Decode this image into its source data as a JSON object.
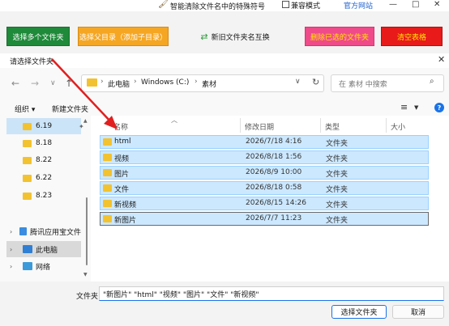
{
  "app": {
    "title": "智能清除文件名中的特殊符号",
    "compat_label": "兼容模式",
    "official_link": "官方网站",
    "toolbar": {
      "select_folders": "选择多个文件夹",
      "select_parent": "选择父目录（添加子目录）",
      "swap_names": "新旧文件夹名互换",
      "delete_selected": "删除已选的文件夹",
      "clear_table": "清空表格"
    }
  },
  "dialog": {
    "title": "请选择文件夹",
    "breadcrumb": [
      "此电脑",
      "Windows (C:)",
      "素材"
    ],
    "search_placeholder": "在 素材 中搜索",
    "organize_label": "组织 ▾",
    "new_folder_label": "新建文件夹",
    "nav_items": [
      "6.19",
      "8.18",
      "8.22",
      "6.22",
      "8.23"
    ],
    "tree": {
      "tencent": "腾讯应用宝文件",
      "thispc": "此电脑",
      "network": "网络"
    },
    "columns": {
      "name": "名称",
      "modified": "修改日期",
      "type": "类型",
      "size": "大小"
    },
    "files": [
      {
        "name": "html",
        "modified": "2026/7/18 4:16",
        "type": "文件夹"
      },
      {
        "name": "视频",
        "modified": "2026/8/18 1:56",
        "type": "文件夹"
      },
      {
        "name": "图片",
        "modified": "2026/8/9 10:00",
        "type": "文件夹"
      },
      {
        "name": "文件",
        "modified": "2026/8/18 0:58",
        "type": "文件夹"
      },
      {
        "name": "新视频",
        "modified": "2026/8/15 14:26",
        "type": "文件夹"
      },
      {
        "name": "新图片",
        "modified": "2026/7/7 11:23",
        "type": "文件夹"
      }
    ],
    "filename_label": "文件夹:",
    "filename_value": "\"新图片\" \"html\" \"视频\" \"图片\" \"文件\" \"新视频\"",
    "select_button": "选择文件夹",
    "cancel_button": "取消"
  },
  "colors": {
    "green": "#1f8a3a",
    "orange": "#f5a623",
    "pink": "#f04a8a",
    "red": "#e81a1a",
    "selection": "#cce8ff"
  }
}
